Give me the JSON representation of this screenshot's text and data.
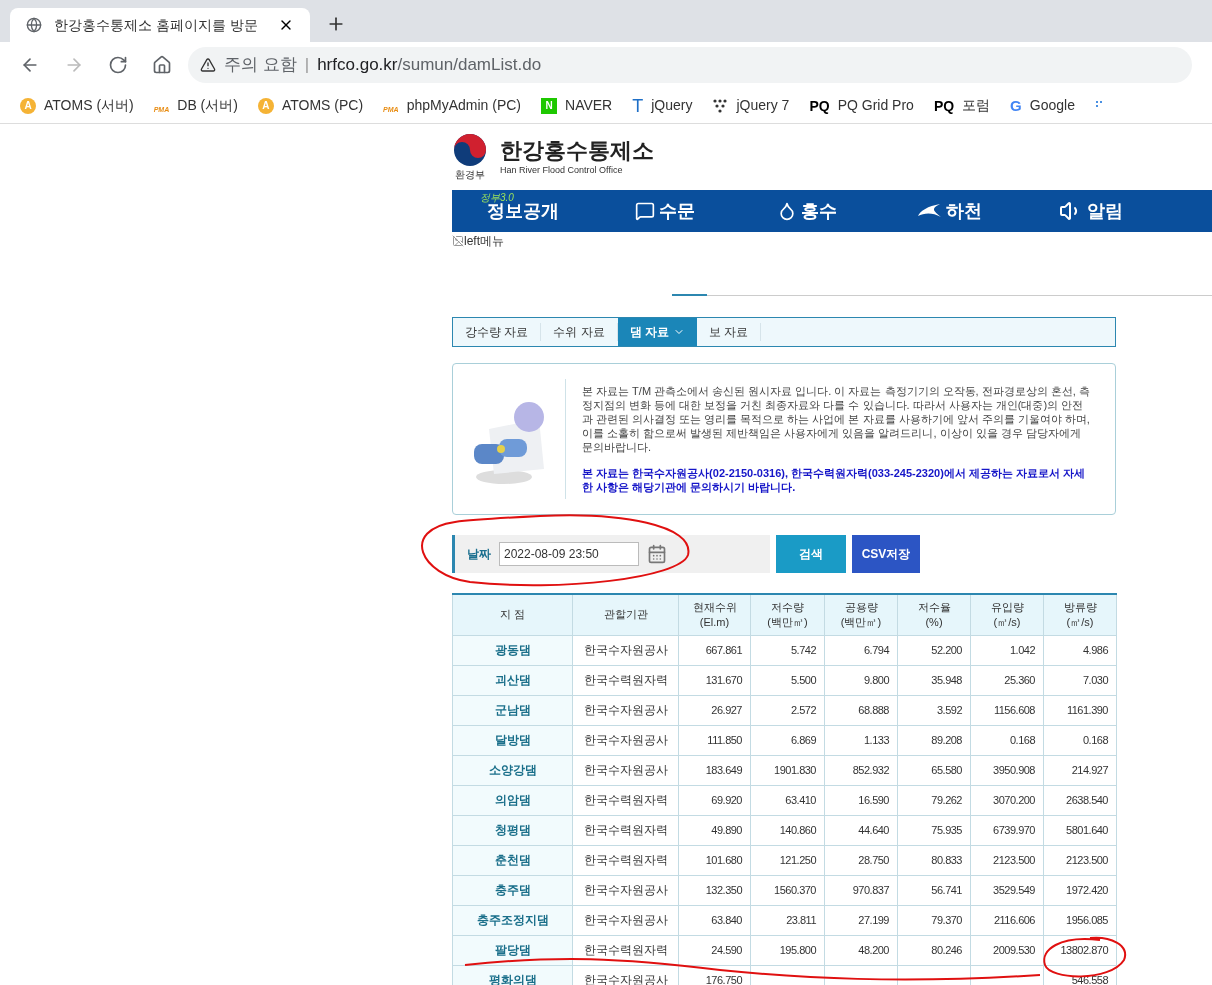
{
  "browser": {
    "tab_title": "한강홍수통제소 홈페이지를 방문",
    "security": "주의 요함",
    "separator": "|",
    "url_host": "hrfco.go.kr",
    "url_path": "/sumun/damList.do",
    "bookmarks": [
      {
        "kind": "circle",
        "mark": "A",
        "label": "ATOMS (서버)"
      },
      {
        "kind": "pma",
        "mark": "PMA",
        "label": "DB (서버)"
      },
      {
        "kind": "circle",
        "mark": "A",
        "label": "ATOMS (PC)"
      },
      {
        "kind": "pma",
        "mark": "PMA",
        "label": "phpMyAdmin (PC)"
      },
      {
        "kind": "square",
        "mark": "N",
        "label": "NAVER"
      },
      {
        "kind": "letter",
        "mark": "T",
        "label": "jQuery"
      },
      {
        "kind": "dots",
        "label": "jQuery 7"
      },
      {
        "kind": "bold",
        "mark": "PQ",
        "label": "PQ Grid Pro"
      },
      {
        "kind": "bold",
        "mark": "PQ",
        "label": "포럼"
      },
      {
        "kind": "google",
        "mark": "G",
        "label": "Google"
      },
      {
        "kind": "partial"
      }
    ]
  },
  "site": {
    "org_caption": "환경부",
    "title": "한강홍수통제소",
    "subtitle": "Han River Flood Control Office",
    "nav": [
      {
        "kind": "text",
        "badge": "정부3.0",
        "label": "정보공개"
      },
      {
        "kind": "chat",
        "label": "수문"
      },
      {
        "kind": "drop",
        "label": "홍수"
      },
      {
        "kind": "river",
        "label": "하천"
      },
      {
        "kind": "speaker",
        "label": "알림"
      }
    ],
    "broken_image_alt": "left메뉴",
    "subtabs": [
      {
        "label": "강수량 자료",
        "selected": false
      },
      {
        "label": "수위 자료",
        "selected": false
      },
      {
        "label": "댐 자료",
        "selected": true
      },
      {
        "label": "보 자료",
        "selected": false
      }
    ],
    "notice": "본 자료는 T/M 관측소에서 송신된 원시자료 입니다. 이 자료는 측정기기의 오작동, 전파경로상의 혼선, 측정지점의 변화 등에 대한 보정을 거친 최종자료와 다를 수 있습니다. 따라서 사용자는 개인(대중)의 안전과 관련된 의사결정 또는 영리를 목적으로 하는 사업에 본 자료를 사용하기에 앞서 주의를 기울여야 하며, 이를 소홀히 함으로써 발생된 제반책임은 사용자에게 있음을 알려드리니, 이상이 있을 경우 담당자에게 문의바랍니다.",
    "notice_highlight": "본 자료는 한국수자원공사(02-2150-0316), 한국수력원자력(033-245-2320)에서 제공하는 자료로서 자세한 사항은 해당기관에 문의하시기 바랍니다.",
    "search": {
      "label": "날짜",
      "value": "2022-08-09 23:50",
      "search_button": "검색",
      "csv_button": "CSV저장"
    },
    "table": {
      "columns": [
        "지 점",
        "관할기관",
        "현재수위\n(El.m)",
        "저수량\n(백만㎥)",
        "공용량\n(백만㎥)",
        "저수율\n(%)",
        "유입량\n(㎥/s)",
        "방류량\n(㎥/s)"
      ],
      "rows": [
        [
          "광동댐",
          "한국수자원공사",
          "667.861",
          "5.742",
          "6.794",
          "52.200",
          "1.042",
          "4.986"
        ],
        [
          "괴산댐",
          "한국수력원자력",
          "131.670",
          "5.500",
          "9.800",
          "35.948",
          "25.360",
          "7.030"
        ],
        [
          "군남댐",
          "한국수자원공사",
          "26.927",
          "2.572",
          "68.888",
          "3.592",
          "1156.608",
          "1161.390"
        ],
        [
          "달방댐",
          "한국수자원공사",
          "111.850",
          "6.869",
          "1.133",
          "89.208",
          "0.168",
          "0.168"
        ],
        [
          "소양강댐",
          "한국수자원공사",
          "183.649",
          "1901.830",
          "852.932",
          "65.580",
          "3950.908",
          "214.927"
        ],
        [
          "의암댐",
          "한국수력원자력",
          "69.920",
          "63.410",
          "16.590",
          "79.262",
          "3070.200",
          "2638.540"
        ],
        [
          "청평댐",
          "한국수력원자력",
          "49.890",
          "140.860",
          "44.640",
          "75.935",
          "6739.970",
          "5801.640"
        ],
        [
          "춘천댐",
          "한국수력원자력",
          "101.680",
          "121.250",
          "28.750",
          "80.833",
          "2123.500",
          "2123.500"
        ],
        [
          "충주댐",
          "한국수자원공사",
          "132.350",
          "1560.370",
          "970.837",
          "56.741",
          "3529.549",
          "1972.420"
        ],
        [
          "충주조정지댐",
          "한국수자원공사",
          "63.840",
          "23.811",
          "27.199",
          "79.370",
          "2116.606",
          "1956.085"
        ],
        [
          "팔당댐",
          "한국수력원자력",
          "24.590",
          "195.800",
          "48.200",
          "80.246",
          "2009.530",
          "13802.870"
        ],
        [
          "평화의댐",
          "한국수자원공사",
          "176.750",
          null,
          null,
          null,
          null,
          "546.558"
        ]
      ]
    }
  }
}
